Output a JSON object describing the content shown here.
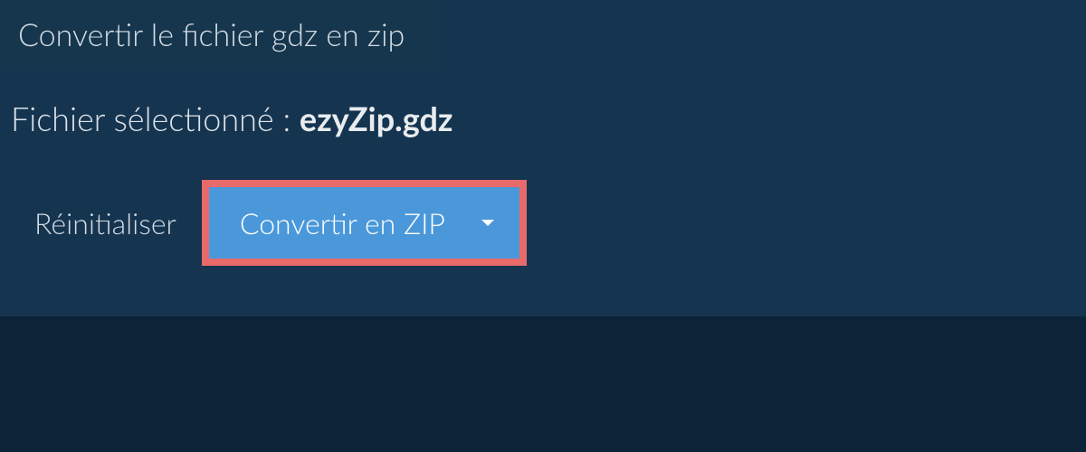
{
  "tab": {
    "title": "Convertir le fichier gdz en zip"
  },
  "file": {
    "label_prefix": "Fichier sélectionné : ",
    "name": "ezyZip.gdz"
  },
  "actions": {
    "reset_label": "Réinitialiser",
    "convert_label": "Convertir en ZIP"
  },
  "colors": {
    "panel_bg": "#15344f",
    "page_bg": "#0c2338",
    "accent_button": "#4a98da",
    "highlight_border": "#e86a6a"
  }
}
